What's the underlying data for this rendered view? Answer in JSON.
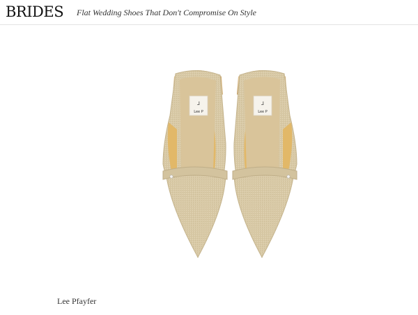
{
  "header": {
    "logo_text": "BRIDES",
    "article_title": "Flat Wedding Shoes That Don't Compromise On Style"
  },
  "product_image": {
    "label_text_left": "Lee P",
    "label_text_right": "Lee P",
    "colors": {
      "canvas": "#d8c9a6",
      "fringe": "#cfae79",
      "insole": "#d9c49a",
      "lining": "#e2b868"
    }
  },
  "caption": {
    "credit": "Lee Pfayfer"
  }
}
